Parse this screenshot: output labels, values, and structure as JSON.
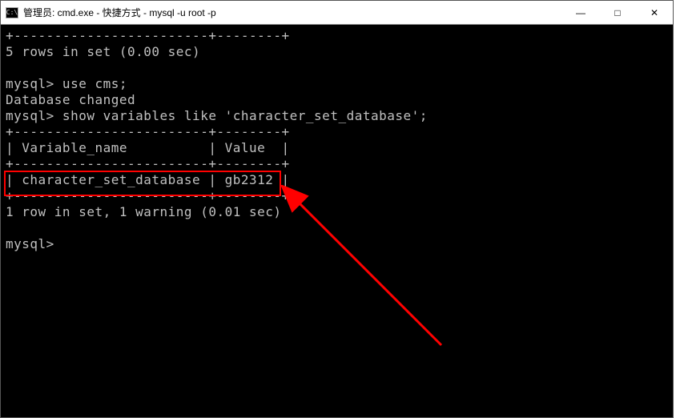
{
  "titlebar": {
    "icon_label": "C:\\",
    "title": "管理员: cmd.exe - 快捷方式 - mysql  -u root -p"
  },
  "window_controls": {
    "minimize": "—",
    "maximize": "□",
    "close": "✕"
  },
  "terminal": {
    "line1": "+------------------------+--------+",
    "line2": "5 rows in set (0.00 sec)",
    "line3": "",
    "line4_prompt": "mysql>",
    "line4_cmd": " use cms;",
    "line5": "Database changed",
    "line6_prompt": "mysql>",
    "line6_cmd": " show variables like 'character_set_database';",
    "line7": "+------------------------+--------+",
    "line8": "| Variable_name          | Value  |",
    "line9": "+------------------------+--------+",
    "line10": "| character_set_database | gb2312 |",
    "line11": "+------------------------+--------+",
    "line12": "1 row in set, 1 warning (0.01 sec)",
    "line13": "",
    "line14_prompt": "mysql>"
  },
  "chart_data": {
    "type": "table",
    "title": "MySQL show variables like 'character_set_database'",
    "columns": [
      "Variable_name",
      "Value"
    ],
    "rows": [
      [
        "character_set_database",
        "gb2312"
      ]
    ],
    "footer": "1 row in set, 1 warning (0.01 sec)",
    "preceding_note": "5 rows in set (0.00 sec)",
    "commands": [
      "use cms;",
      "show variables like 'character_set_database';"
    ],
    "database_changed": true
  }
}
